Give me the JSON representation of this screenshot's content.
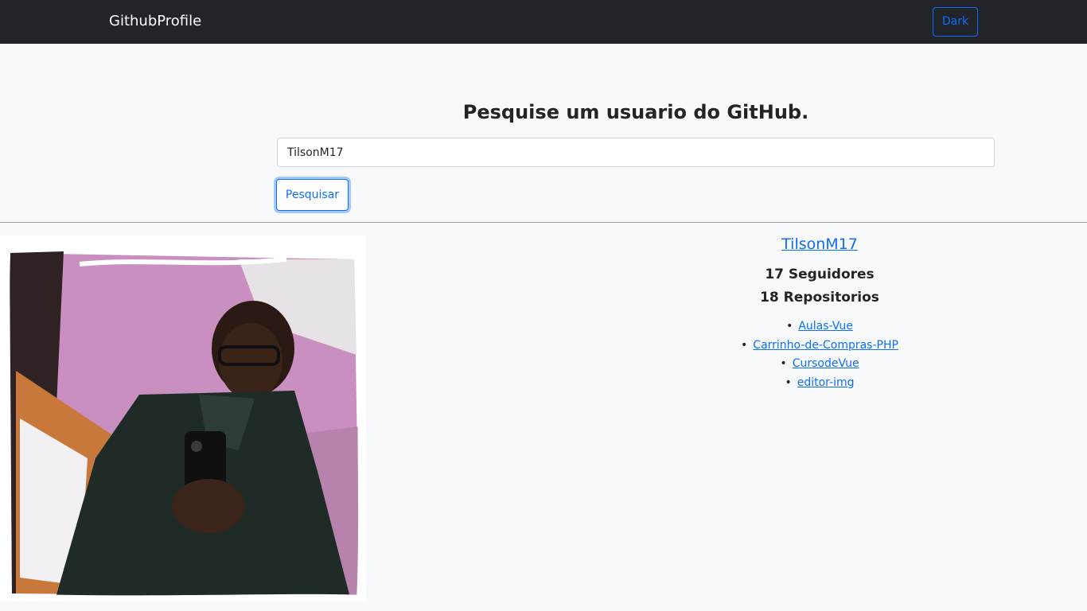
{
  "navbar": {
    "brand": "GithubProfile",
    "theme_button_label": "Dark"
  },
  "search": {
    "title": "Pesquise um usuario do GitHub.",
    "input_value": "TilsonM17",
    "button_label": "Pesquisar"
  },
  "profile": {
    "username": "TilsonM17",
    "followers": "17 Seguidores",
    "repositories": "18 Repositorios",
    "repos": [
      {
        "name": "Aulas-Vue"
      },
      {
        "name": "Carrinho-de-Compras-PHP"
      },
      {
        "name": "CursodeVue"
      },
      {
        "name": "editor-img"
      }
    ]
  },
  "colors": {
    "navbar_bg": "#212529",
    "page_bg": "#f8f9fa",
    "accent": "#0d6efd"
  }
}
